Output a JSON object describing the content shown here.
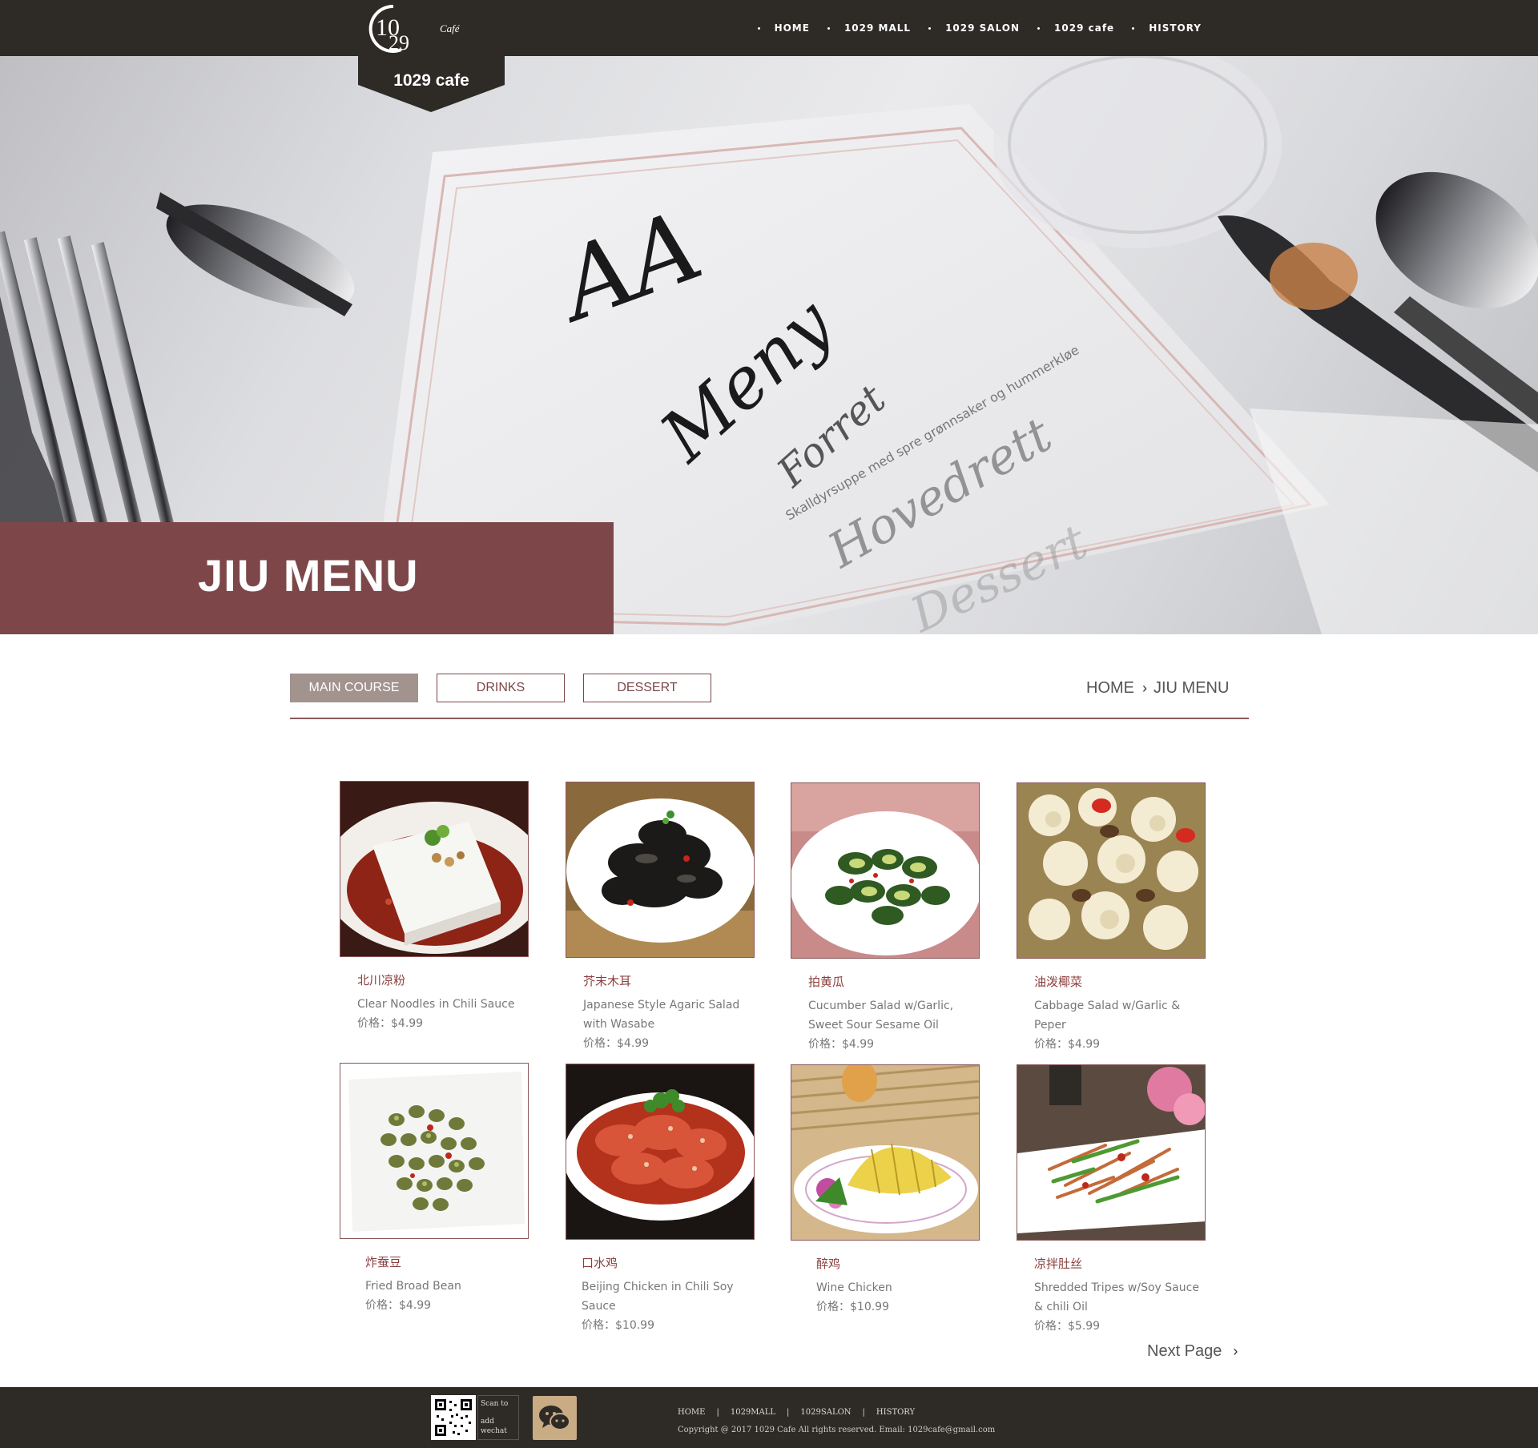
{
  "brand": {
    "logo_text": "1029 cafe",
    "logo_small": "Café",
    "logo_digits_top": "10",
    "logo_digits_bottom": "29"
  },
  "nav": {
    "items": [
      {
        "label": "HOME"
      },
      {
        "label": "1029 MALL"
      },
      {
        "label": "1029 SALON"
      },
      {
        "label": "1029 cafe"
      },
      {
        "label": "HISTORY"
      }
    ]
  },
  "hero": {
    "title": "JIU MENU",
    "menu_card_text": [
      "AA",
      "Meny",
      "Forret",
      "Hovedrett",
      "Dessert"
    ]
  },
  "tabs": [
    {
      "label": "MAIN COURSE",
      "active": true
    },
    {
      "label": "DRINKS",
      "active": false
    },
    {
      "label": "DESSERT",
      "active": false
    }
  ],
  "breadcrumb": {
    "home": "HOME",
    "current": "JIU MENU"
  },
  "products": [
    {
      "name_cn": "北川凉粉",
      "name_en": "Clear Noodles in Chili Sauce",
      "price": "价格：$4.99",
      "icon": "dish-clear-noodles"
    },
    {
      "name_cn": "芥末木耳",
      "name_en": "Japanese Style Agaric Salad with Wasabe",
      "price": "价格：$4.99",
      "icon": "dish-agaric-salad"
    },
    {
      "name_cn": "拍黄瓜",
      "name_en": "Cucumber Salad w/Garlic, Sweet Sour Sesame Oil",
      "price": "价格：$4.99",
      "icon": "dish-cucumber-salad"
    },
    {
      "name_cn": "油泼椰菜",
      "name_en": "Cabbage Salad w/Garlic & Peper",
      "price": "价格：$4.99",
      "icon": "dish-cabbage-salad"
    },
    {
      "name_cn": "炸蚕豆",
      "name_en": "Fried Broad Bean",
      "price": "价格：$4.99",
      "icon": "dish-broad-bean"
    },
    {
      "name_cn": "口水鸡",
      "name_en": "Beijing Chicken in Chili Soy Sauce",
      "price": "价格：$10.99",
      "icon": "dish-chili-chicken"
    },
    {
      "name_cn": "醉鸡",
      "name_en": "Wine Chicken",
      "price": "价格：$10.99",
      "icon": "dish-wine-chicken"
    },
    {
      "name_cn": "凉拌肚丝",
      "name_en": "Shredded Tripes w/Soy Sauce & chili Oil",
      "price": "价格：$5.99",
      "icon": "dish-shredded-tripes"
    }
  ],
  "pagination": {
    "next_label": "Next Page"
  },
  "footer": {
    "qr_label_line1": "Scan to",
    "qr_label_line2": "add wechat",
    "links": [
      "HOME",
      "1029MALL",
      "1029SALON",
      "HISTORY"
    ],
    "copyright": "Copyright @ 2017 1029 Cafe All rights reserved.   Email:  1029cafe@gmail.com"
  },
  "colors": {
    "topbar": "#2e2a26",
    "accent": "#7d4749",
    "tab_active": "#a2938f",
    "wechat": "#c9ab84"
  }
}
